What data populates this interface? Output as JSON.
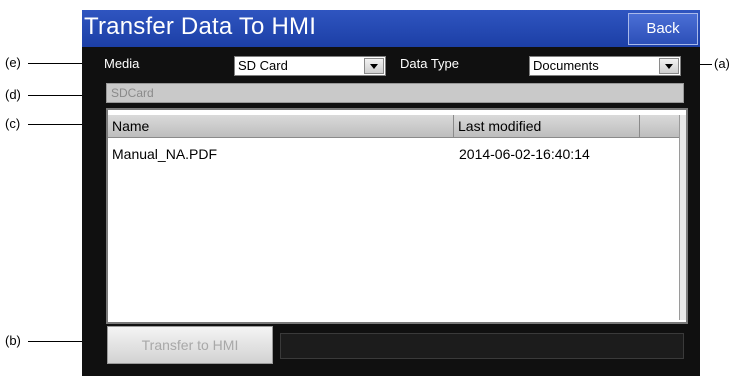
{
  "window": {
    "title": "Transfer Data To HMI",
    "back_label": "Back"
  },
  "media": {
    "label": "Media",
    "selected": "SD Card"
  },
  "data_type": {
    "label": "Data Type",
    "selected": "Documents"
  },
  "path": {
    "value": "SDCard"
  },
  "file_list": {
    "columns": [
      "Name",
      "Last modified",
      ""
    ],
    "rows": [
      {
        "name": "Manual_NA.PDF",
        "modified": "2014-06-02-16:40:14"
      }
    ]
  },
  "transfer": {
    "label": "Transfer to HMI"
  },
  "callouts": {
    "a": "(a)",
    "b": "(b)",
    "c": "(c)",
    "d": "(d)",
    "e": "(e)"
  }
}
